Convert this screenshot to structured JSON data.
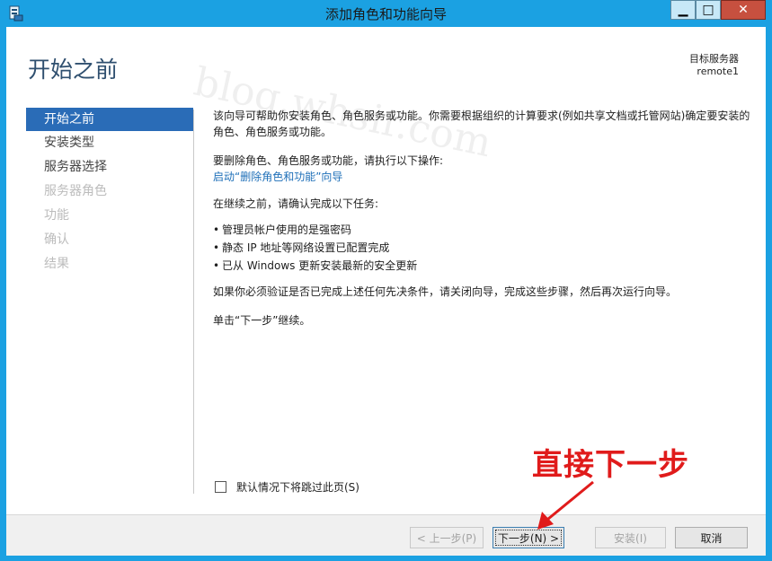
{
  "window": {
    "title": "添加角色和功能向导",
    "controls": {
      "minimize": "▁",
      "maximize": "□",
      "close": "✕"
    }
  },
  "header": {
    "page_title": "开始之前",
    "target_label": "目标服务器",
    "target_value": "remote1"
  },
  "nav": {
    "items": [
      {
        "label": "开始之前",
        "state": "active"
      },
      {
        "label": "安装类型",
        "state": "enabled"
      },
      {
        "label": "服务器选择",
        "state": "enabled"
      },
      {
        "label": "服务器角色",
        "state": "disabled"
      },
      {
        "label": "功能",
        "state": "disabled"
      },
      {
        "label": "确认",
        "state": "disabled"
      },
      {
        "label": "结果",
        "state": "disabled"
      }
    ]
  },
  "content": {
    "intro": "该向导可帮助你安装角色、角色服务或功能。你需要根据组织的计算要求(例如共享文档或托管网站)确定要安装的角色、角色服务或功能。",
    "remove_text": "要删除角色、角色服务或功能，请执行以下操作:",
    "remove_link": "启动“删除角色和功能”向导",
    "before_text": "在继续之前，请确认完成以下任务:",
    "bullets": [
      "管理员帐户使用的是强密码",
      "静态 IP 地址等网络设置已配置完成",
      "已从 Windows 更新安装最新的安全更新"
    ],
    "verify_text": "如果你必须验证是否已完成上述任何先决条件，请关闭向导，完成这些步骤，然后再次运行向导。",
    "continue_text": "单击“下一步”继续。"
  },
  "skip_checkbox": {
    "label": "默认情况下将跳过此页(S)",
    "checked": false
  },
  "buttons": {
    "prev": "< 上一步(P)",
    "next": "下一步(N) >",
    "install": "安装(I)",
    "cancel": "取消"
  },
  "annotation": {
    "text": "直接下一步",
    "color": "#e01b1b"
  },
  "watermark": "blog.whsir.com",
  "colors": {
    "titlebar": "#1ba1e2",
    "nav_active": "#2a6cb7",
    "link": "#1e6fb8",
    "close": "#c7503f"
  }
}
